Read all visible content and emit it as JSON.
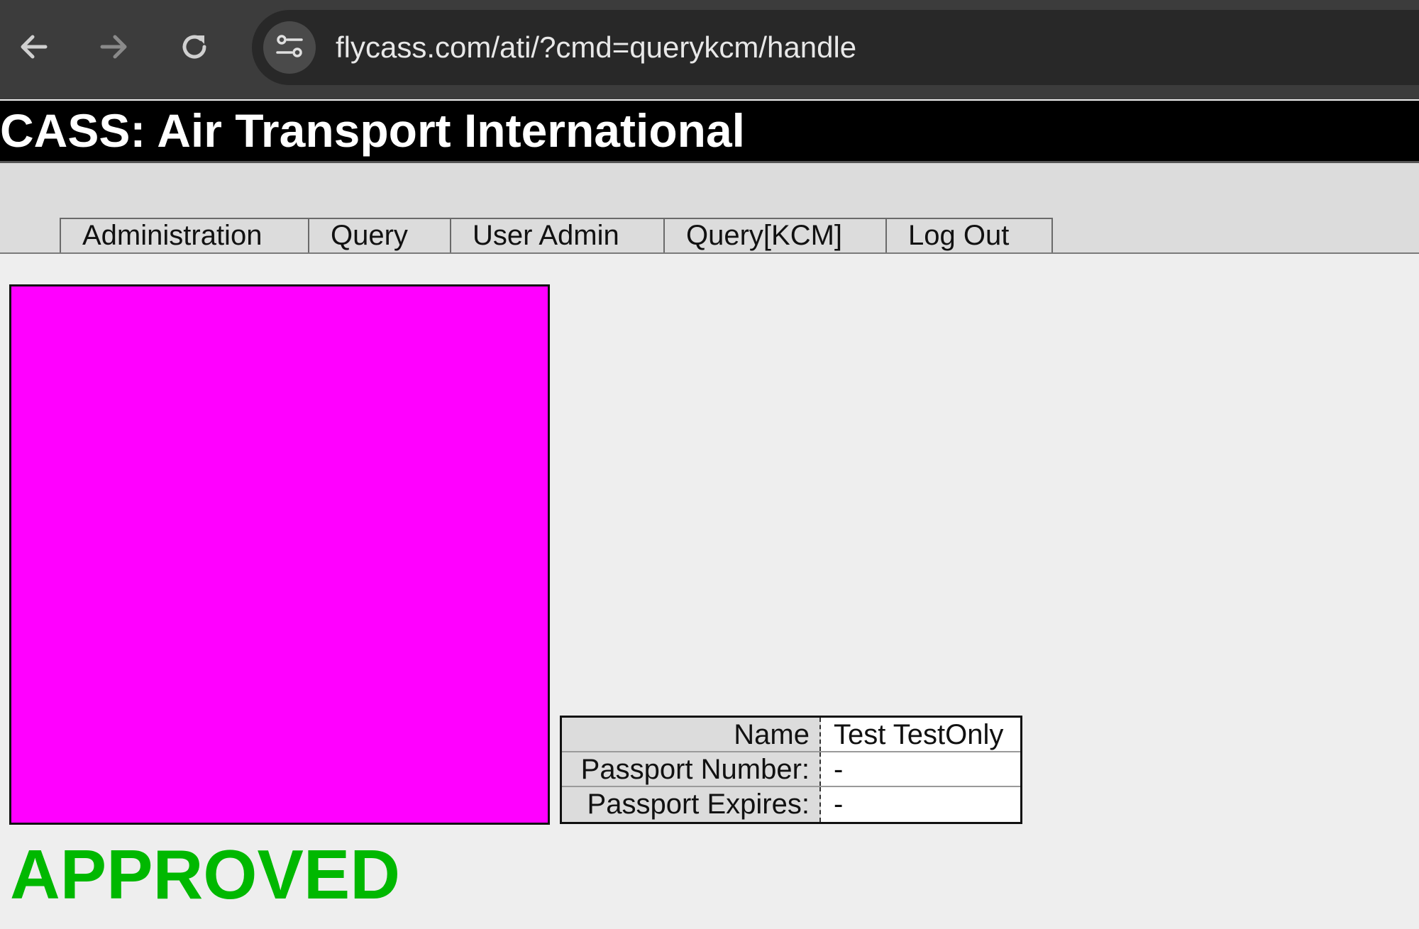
{
  "browser": {
    "url": "flycass.com/ati/?cmd=querykcm/handle",
    "icons": {
      "back": "back-arrow-icon",
      "forward": "forward-arrow-icon",
      "reload": "reload-icon",
      "site_info": "site-settings-icon"
    }
  },
  "page": {
    "title": "CASS: Air Transport International"
  },
  "menu": {
    "items": [
      {
        "label": "Administration"
      },
      {
        "label": "Query"
      },
      {
        "label": "User Admin"
      },
      {
        "label": "Query[KCM]"
      },
      {
        "label": "Log Out"
      }
    ]
  },
  "photo": {
    "color": "#ff00ff"
  },
  "info": {
    "rows": [
      {
        "label": "Name",
        "value": "Test TestOnly"
      },
      {
        "label": "Passport Number:",
        "value": "-"
      },
      {
        "label": "Passport Expires:",
        "value": "-"
      }
    ]
  },
  "status": {
    "text": "APPROVED",
    "color": "#00b800"
  }
}
